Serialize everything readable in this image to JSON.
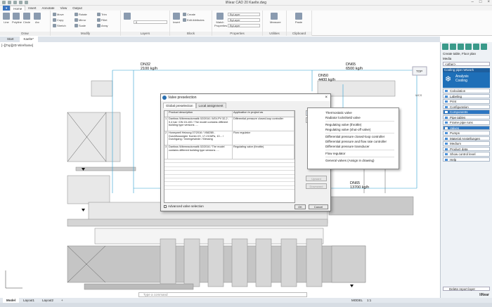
{
  "window": {
    "title": "liNear CAD 20   Kaelte.dwg"
  },
  "ribbon": {
    "tabs": [
      "Home",
      "Insert",
      "Annotate",
      "View",
      "Output"
    ],
    "active_tab": "Home",
    "groups": {
      "draw": "Draw",
      "modify": "Modify",
      "layers": "Layers",
      "block": "Block",
      "properties": "Properties",
      "utilities": "Utilities",
      "clipboard": "Clipboard"
    },
    "draw_buttons": [
      "Line",
      "Polyline",
      "Circle",
      "Arc"
    ],
    "modify_buttons": [
      "Move",
      "Copy",
      "Stretch",
      "Rotate",
      "Mirror",
      "Scale",
      "Trim",
      "Fillet",
      "Array"
    ],
    "layer_combo": "0",
    "block_buttons": [
      "Insert",
      "Create",
      "Edit Attributes"
    ],
    "properties": {
      "match": "Match Properties",
      "bylayer_1": "ByLayer",
      "bylayer_2": "ByLayer",
      "bylayer_3": "ByLayer"
    },
    "utilities_button": "Measure",
    "paste_button": "Paste"
  },
  "doc_tabs": [
    "Start",
    "Kaelte*"
  ],
  "view_label": "[−][Top][2D Wireframe]",
  "dimensions": {
    "d1": "DN32",
    "d1v": "2100  kg/h",
    "d2": "DN50",
    "d2v": "4400  kg/h",
    "d3": "DN65",
    "d3v": "6500  kg/h",
    "d4": "DN65",
    "d4v": "13700  kg/h"
  },
  "viewcube": {
    "top": "TOP",
    "wcs": "WCS"
  },
  "right_panel": {
    "title": "Create table, Floor plan",
    "media_label": "Media",
    "media_value": "<other>",
    "network": "Cooling pipe network",
    "hero_line1": "Analysis",
    "hero_line2": "Cooling",
    "items": [
      "Calculation",
      "Labeling",
      "Print",
      "Configuration",
      "Components",
      "Pipe tables",
      "Frame pipe runs",
      "Valves",
      "Pumps",
      "Material Anstellungen",
      "Medium",
      "Product data",
      "Show control level",
      "Help"
    ],
    "footer": "Delete report layer",
    "brand": "liNear"
  },
  "dialog": {
    "title": "Valve preselection",
    "tabs": [
      "Global preselection",
      "Local assignment"
    ],
    "headers": [
      "",
      "Product description",
      "Application in project as"
    ],
    "rows": [
      {
        "n": "1",
        "desc": "Danfoss Wärmeautomatik 02/2016 / ASV-PV 32,2 - 0,4 bar / DN 15-100 / The model contains different building type versions ....",
        "app": "Differential pressure closed-loop controller"
      },
      {
        "n": "2",
        "desc": "Honeywell Heizung 07/2016 / V5825B - Durchflussregler Kombi-VX, 17-210kPa, 10... / Durchgang / Innengewinde / Messing",
        "app": "Flow regulator"
      },
      {
        "n": "3",
        "desc": "Danfoss Wärmeautomatik 02/2016 / The model contains different building type versions ....",
        "app": "Regulating valve (throttle)"
      }
    ],
    "side_buttons": [
      "Add",
      "Delete",
      "Upward",
      "Downward",
      "VDI file"
    ],
    "checkbox": "Advanced valve selection",
    "ok": "OK",
    "cancel": "Cancel"
  },
  "dropdown": {
    "items_a": [
      "Thermostatic valve",
      "Radiator lockshield valve"
    ],
    "items_b": [
      "Regulating valve (throttle)",
      "Regulating valve (shut-off valve)"
    ],
    "items_c": [
      "Differential pressure closed-loop controller",
      "Differential pressure and flow rate controller",
      "Differential pressure transducer"
    ],
    "items_d": [
      "Flow regulator"
    ],
    "items_e": [
      "General valves (Assign in drawing)"
    ]
  },
  "command": {
    "placeholder": "Type a command"
  },
  "layout_tabs": [
    "Model",
    "Layout1",
    "Layout2",
    "+"
  ],
  "status": {
    "model": "MODEL",
    "scale": "1:1"
  },
  "colors": {
    "accent": "#1e6fb8",
    "file_tab": "#3a74c0",
    "dim": "#2e9fd0"
  }
}
